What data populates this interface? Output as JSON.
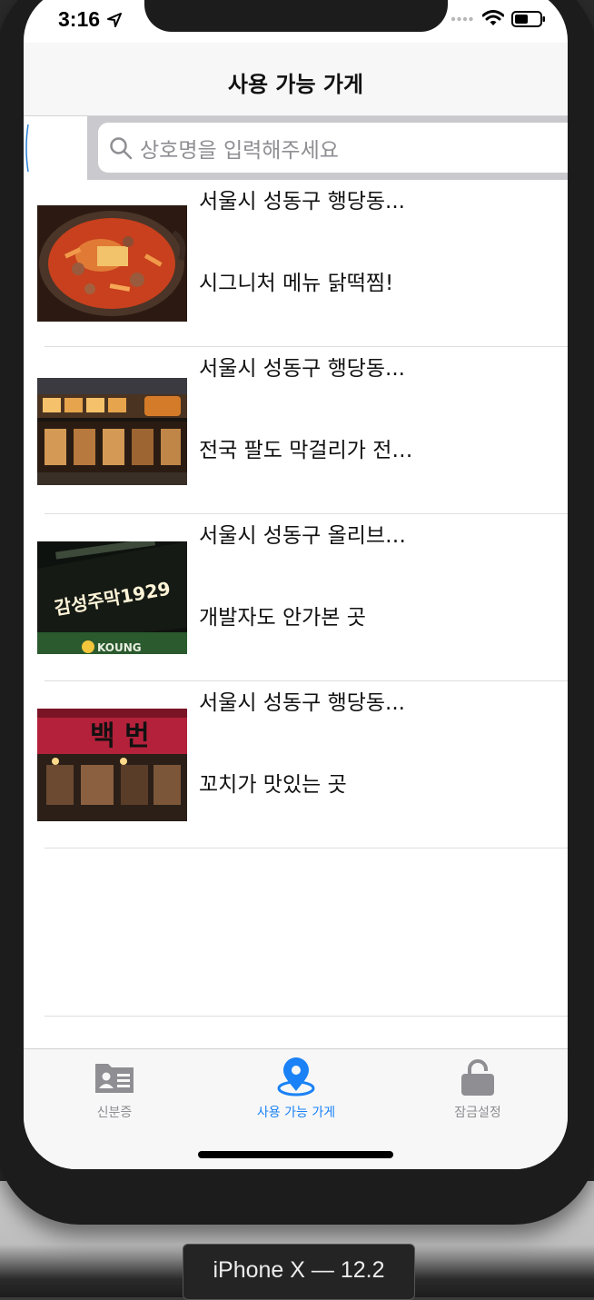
{
  "status_bar": {
    "time": "3:16",
    "icons": [
      "location-arrow-icon",
      "signal-dots-icon",
      "wifi-icon",
      "battery-icon"
    ]
  },
  "nav": {
    "title": "사용 가능 가게"
  },
  "search": {
    "placeholder": "상호명을 입력해주세요",
    "icon": "magnifier-icon"
  },
  "stores": [
    {
      "address": "서울시 성동구 행당동...",
      "description": "시그니처 메뉴 닭떡찜!",
      "image": "tteokjjim-dish"
    },
    {
      "address": "서울시 성동구 행당동...",
      "description": "전국 팔도 막걸리가 전…",
      "image": "storefront-night"
    },
    {
      "address": "서울시 성동구 올리브…",
      "description": "개발자도 안가본 곳",
      "image": "neon-sign-1929"
    },
    {
      "address": "서울시 성동구 행당동...",
      "description": "꼬치가 맛있는 곳",
      "image": "red-sign-storefront"
    }
  ],
  "store_images": {
    "neon_sign_text": "감성주막1929",
    "neon_sign_subtext": "KOUNG",
    "red_sign_text": "백 번"
  },
  "tab_bar": {
    "tabs": [
      {
        "label": "신분증",
        "icon": "id-card-icon",
        "active": false
      },
      {
        "label": "사용 가능 가게",
        "icon": "location-pin-icon",
        "active": true
      },
      {
        "label": "잠금설정",
        "icon": "unlock-icon",
        "active": false
      }
    ]
  },
  "simulator": {
    "device_label": "iPhone X — 12.2"
  },
  "colors": {
    "accent": "#1a82f6",
    "tab_inactive": "#8e8e93",
    "nav_background": "#f7f7f7",
    "search_bar_background": "#c9c9ce",
    "placeholder": "#8e8e93"
  }
}
